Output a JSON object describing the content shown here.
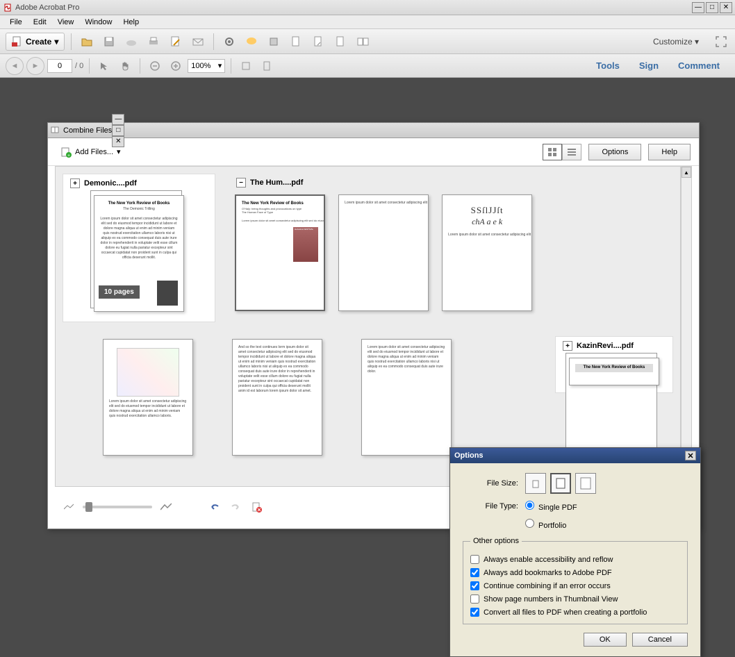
{
  "app": {
    "title": "Adobe Acrobat Pro"
  },
  "menubar": [
    "File",
    "Edit",
    "View",
    "Window",
    "Help"
  ],
  "toolbar": {
    "create": "Create",
    "customize": "Customize"
  },
  "nav": {
    "page_input": "0",
    "page_total": "/ 0",
    "zoom": "100%"
  },
  "right_panels": {
    "tools": "Tools",
    "sign": "Sign",
    "comment": "Comment"
  },
  "combine": {
    "title": "Combine Files",
    "add_files": "Add Files...",
    "options_btn": "Options",
    "help_btn": "Help",
    "files": [
      {
        "name": "Demonic....pdf",
        "pages_badge": "10 pages",
        "expanded": false
      },
      {
        "name": "The Hum....pdf",
        "expanded": true
      },
      {
        "name": "KazinRevi....pdf",
        "expanded": false
      }
    ]
  },
  "options_dlg": {
    "title": "Options",
    "file_size_label": "File Size:",
    "file_type_label": "File Type:",
    "file_type_single": "Single PDF",
    "file_type_portfolio": "Portfolio",
    "other_legend": "Other options",
    "checks": [
      {
        "label": "Always enable accessibility and reflow",
        "checked": false
      },
      {
        "label": "Always add bookmarks to Adobe PDF",
        "checked": true
      },
      {
        "label": "Continue combining if an error occurs",
        "checked": true
      },
      {
        "label": "Show page numbers in Thumbnail View",
        "checked": false
      },
      {
        "label": "Convert all files to PDF when creating a portfolio",
        "checked": true
      }
    ],
    "ok": "OK",
    "cancel": "Cancel"
  }
}
